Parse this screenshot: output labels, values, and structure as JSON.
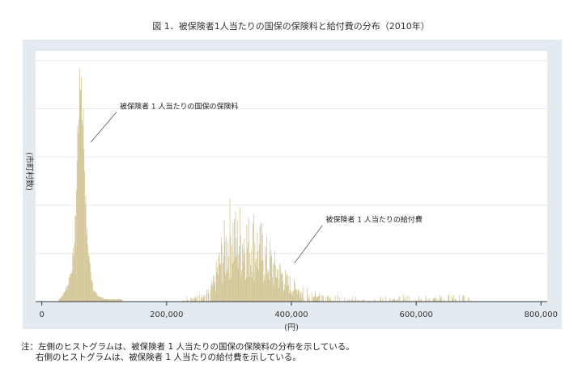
{
  "title": "図 1．被保険者1人当たりの国保の保険料と給付費の分布（2010年）",
  "note": {
    "line1": "注：左側のヒストグラムは、被保険者 1 人当たりの国保の保険料の分布を示している。",
    "line2": "右側のヒストグラムは、被保険者 1 人当たりの給付費を示している。"
  },
  "colors": {
    "outer_bg": "#e4ebf0",
    "plot_bg": "#ffffff",
    "grid": "#e6eaee",
    "bars": "#d1c493",
    "axis": "#333333"
  },
  "chart_data": {
    "type": "histogram",
    "xlabel": "(円)",
    "ylabel": "(市町村数)",
    "xlim": [
      -10000,
      810000
    ],
    "ylim": [
      0,
      52
    ],
    "x_ticks": [
      0,
      200000,
      400000,
      600000,
      800000
    ],
    "x_tick_labels": [
      "0",
      "200,000",
      "400,000",
      "600,000",
      "800,000"
    ],
    "y_ticks": [
      10,
      20,
      30,
      40,
      50
    ],
    "grid": true,
    "bin_width": 1000,
    "annotations": [
      {
        "text": "被保険者 1 人当たりの国保の保険料",
        "x": 125000,
        "y": 40,
        "arrow_to": [
          78000,
          33
        ]
      },
      {
        "text": "被保険者 1 人当たりの給付費",
        "x": 455000,
        "y": 16.5,
        "arrow_to": [
          405000,
          8
        ]
      }
    ],
    "series": [
      {
        "name": "被保険者 1 人当たりの国保の保険料",
        "type": "dense",
        "bins": [
          [
            27000,
            0.5
          ],
          [
            30000,
            1
          ],
          [
            33000,
            1.5
          ],
          [
            36000,
            2
          ],
          [
            38000,
            3
          ],
          [
            40000,
            3
          ],
          [
            42000,
            4
          ],
          [
            44000,
            6
          ],
          [
            46000,
            6
          ],
          [
            48000,
            8
          ],
          [
            50000,
            10
          ],
          [
            52000,
            13
          ],
          [
            53000,
            16
          ],
          [
            54000,
            21
          ],
          [
            55000,
            25
          ],
          [
            56000,
            30
          ],
          [
            57000,
            36
          ],
          [
            58000,
            40
          ],
          [
            59000,
            45
          ],
          [
            60000,
            43
          ],
          [
            61000,
            47
          ],
          [
            62000,
            51
          ],
          [
            63000,
            48
          ],
          [
            64000,
            42
          ],
          [
            65000,
            44
          ],
          [
            66000,
            38
          ],
          [
            67000,
            35
          ],
          [
            68000,
            30
          ],
          [
            69000,
            25
          ],
          [
            70000,
            20
          ],
          [
            71000,
            16
          ],
          [
            72000,
            14
          ],
          [
            74000,
            11
          ],
          [
            76000,
            9
          ],
          [
            78000,
            6
          ],
          [
            80000,
            5
          ],
          [
            82000,
            3
          ],
          [
            85000,
            2
          ],
          [
            88000,
            1.5
          ],
          [
            92000,
            1
          ],
          [
            96000,
            1
          ],
          [
            100000,
            0.5
          ],
          [
            110000,
            0.5
          ],
          [
            128000,
            0.5
          ]
        ]
      },
      {
        "name": "被保険者 1 人当たりの給付費",
        "type": "sparse",
        "bins": [
          [
            225000,
            0.5
          ],
          [
            240000,
            1
          ],
          [
            250000,
            1
          ],
          [
            256000,
            1
          ],
          [
            262000,
            1.5
          ],
          [
            268000,
            2
          ],
          [
            272000,
            3
          ],
          [
            276000,
            4
          ],
          [
            280000,
            6
          ],
          [
            284000,
            8
          ],
          [
            288000,
            10
          ],
          [
            292000,
            11
          ],
          [
            296000,
            12
          ],
          [
            300000,
            14
          ],
          [
            304000,
            15
          ],
          [
            308000,
            14
          ],
          [
            312000,
            12
          ],
          [
            316000,
            14
          ],
          [
            320000,
            13
          ],
          [
            324000,
            14
          ],
          [
            328000,
            13
          ],
          [
            332000,
            12
          ],
          [
            336000,
            14
          ],
          [
            340000,
            13
          ],
          [
            344000,
            12
          ],
          [
            348000,
            11
          ],
          [
            352000,
            11
          ],
          [
            356000,
            10
          ],
          [
            360000,
            9
          ],
          [
            364000,
            9
          ],
          [
            368000,
            8
          ],
          [
            372000,
            7
          ],
          [
            376000,
            7
          ],
          [
            380000,
            6
          ],
          [
            384000,
            6
          ],
          [
            388000,
            5
          ],
          [
            392000,
            4
          ],
          [
            396000,
            4
          ],
          [
            400000,
            3
          ],
          [
            405000,
            3
          ],
          [
            410000,
            2.5
          ],
          [
            415000,
            2
          ],
          [
            420000,
            2
          ],
          [
            425000,
            2
          ],
          [
            430000,
            1.5
          ],
          [
            440000,
            1.5
          ],
          [
            450000,
            1
          ],
          [
            460000,
            1
          ],
          [
            470000,
            1
          ],
          [
            480000,
            1
          ],
          [
            490000,
            0.5
          ],
          [
            500000,
            1
          ],
          [
            510000,
            0.5
          ],
          [
            520000,
            0.5
          ],
          [
            530000,
            0.5
          ],
          [
            540000,
            0.5
          ],
          [
            545000,
            1
          ],
          [
            560000,
            0.5
          ],
          [
            565000,
            1
          ],
          [
            580000,
            1
          ],
          [
            585000,
            1
          ],
          [
            590000,
            1
          ],
          [
            595000,
            1
          ],
          [
            615000,
            1
          ],
          [
            625000,
            1
          ],
          [
            685000,
            1
          ]
        ]
      }
    ]
  }
}
